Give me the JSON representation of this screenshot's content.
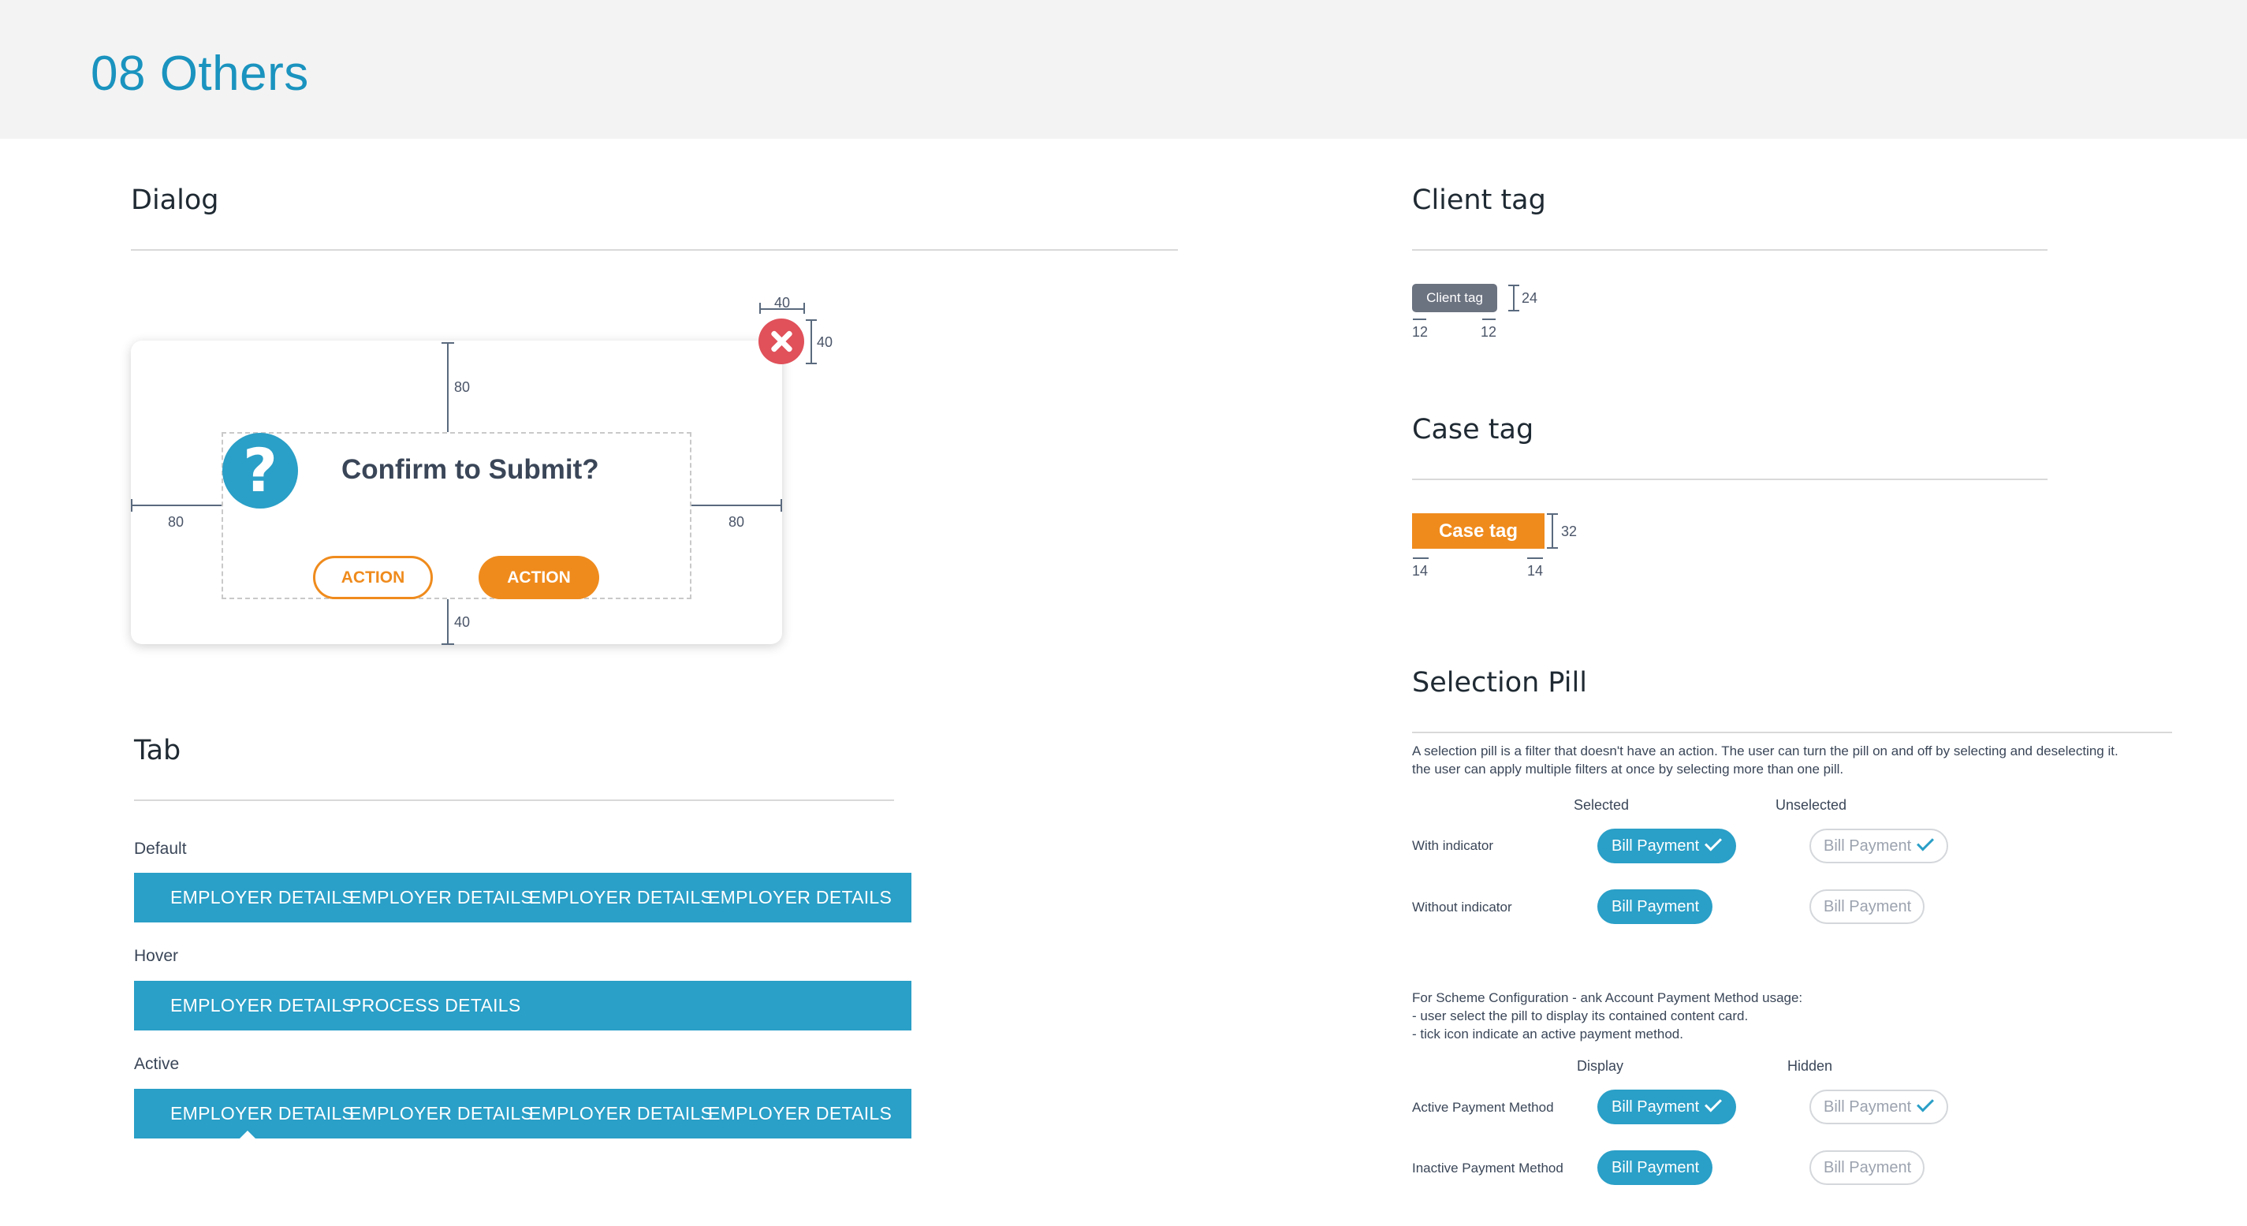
{
  "page_title": "08 Others",
  "dialog": {
    "section_title": "Dialog",
    "message": "Confirm to Submit?",
    "question_glyph": "?",
    "secondary_action": "ACTION",
    "primary_action": "ACTION",
    "dims": {
      "close_w": "40",
      "close_h": "40",
      "top": "80",
      "left": "80",
      "right": "80",
      "bottom": "40"
    }
  },
  "tab": {
    "section_title": "Tab",
    "default": {
      "label": "Default",
      "items": [
        "EMPLOYER DETAILS",
        "EMPLOYER DETAILS",
        "EMPLOYER DETAILS",
        "EMPLOYER DETAILS"
      ]
    },
    "hover": {
      "label": "Hover",
      "items": [
        "EMPLOYER DETAILS",
        "PROCESS DETAILS"
      ]
    },
    "active": {
      "label": "Active",
      "items": [
        "EMPLOYER DETAILS",
        "EMPLOYER DETAILS",
        "EMPLOYER DETAILS",
        "EMPLOYER DETAILS"
      ]
    }
  },
  "client_tag": {
    "section_title": "Client tag",
    "tag_label": "Client tag",
    "dims": {
      "height": "24",
      "pad_left": "12",
      "pad_right": "12"
    }
  },
  "case_tag": {
    "section_title": "Case tag",
    "tag_label": "Case tag",
    "dims": {
      "height": "32",
      "pad_left": "14",
      "pad_right": "14"
    }
  },
  "selection_pill": {
    "section_title": "Selection Pill",
    "description": [
      "A selection pill is a filter that doesn't have an action. The user can turn the pill on and off by selecting and deselecting it.",
      "the user can apply multiple filters at once by selecting more than one pill."
    ],
    "col_selected": "Selected",
    "col_unselected": "Unselected",
    "row_with_indicator": "With indicator",
    "row_without_indicator": "Without indicator",
    "pill_label": "Bill Payment",
    "scheme_notes": [
      "For Scheme Configuration - ank Account Payment Method usage:",
      "- user select the pill to display its contained content card.",
      "- tick icon indicate an active payment method."
    ],
    "col_display": "Display",
    "col_hidden": "Hidden",
    "row_active_method": "Active Payment Method",
    "row_inactive_method": "Inactive Payment Method"
  },
  "colors": {
    "accent_blue": "#2a9fc7",
    "accent_orange": "#ef8b1d",
    "title_blue": "#1a93bf",
    "close_red": "#e0515a",
    "client_tag_gray": "#6b7280"
  }
}
